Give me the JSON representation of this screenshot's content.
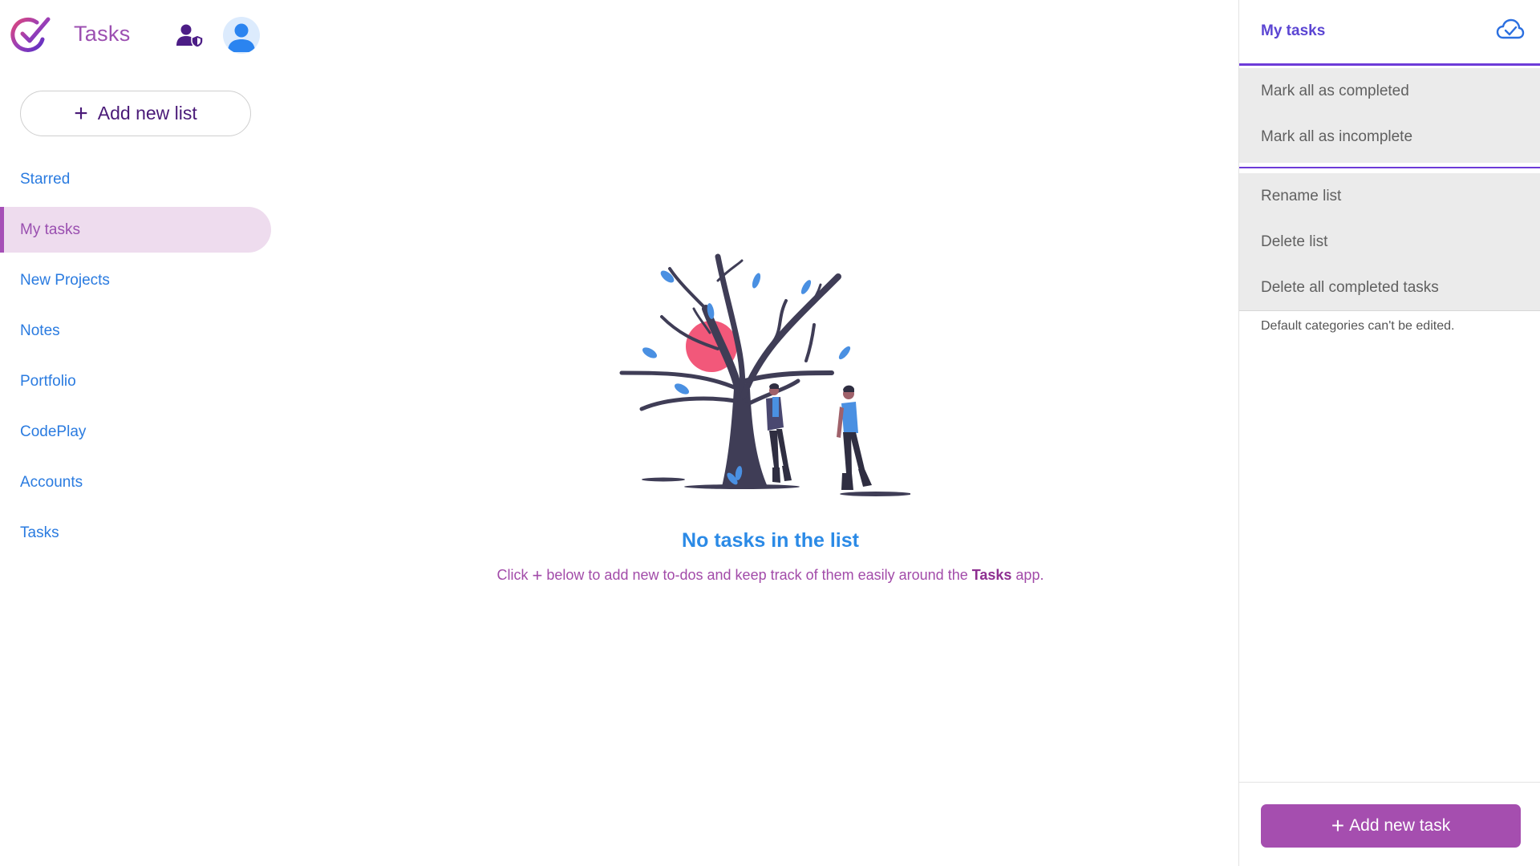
{
  "app": {
    "title": "Tasks"
  },
  "sidebar": {
    "add_list_label": "Add new list",
    "items": [
      {
        "label": "Starred",
        "active": false
      },
      {
        "label": "My tasks",
        "active": true
      },
      {
        "label": "New Projects",
        "active": false
      },
      {
        "label": "Notes",
        "active": false
      },
      {
        "label": "Portfolio",
        "active": false
      },
      {
        "label": "CodePlay",
        "active": false
      },
      {
        "label": "Accounts",
        "active": false
      },
      {
        "label": "Tasks",
        "active": false
      }
    ]
  },
  "main": {
    "empty_title": "No tasks in the list",
    "empty_sub_prefix": "Click",
    "empty_sub_plus": "+",
    "empty_sub_middle": " below to add new to-dos and keep track of them easily around the ",
    "empty_sub_app": "Tasks",
    "empty_sub_suffix": " app."
  },
  "panel": {
    "title": "My tasks",
    "actions_group1": [
      "Mark all as completed",
      "Mark all as incomplete"
    ],
    "actions_group2": [
      "Rename list",
      "Delete list",
      "Delete all completed tasks"
    ],
    "note": "Default categories can't be edited.",
    "add_task_label": "Add new task",
    "add_task_plus": "+"
  },
  "colors": {
    "brand": "#a54eaf",
    "link_blue": "#2a7be0",
    "accent_purple": "#6d3bd8"
  },
  "icons": {
    "logo": "check-circle-logo-icon",
    "admin": "user-shield-icon",
    "avatar": "user-avatar-icon",
    "sync": "cloud-check-icon",
    "plus": "plus-icon"
  }
}
